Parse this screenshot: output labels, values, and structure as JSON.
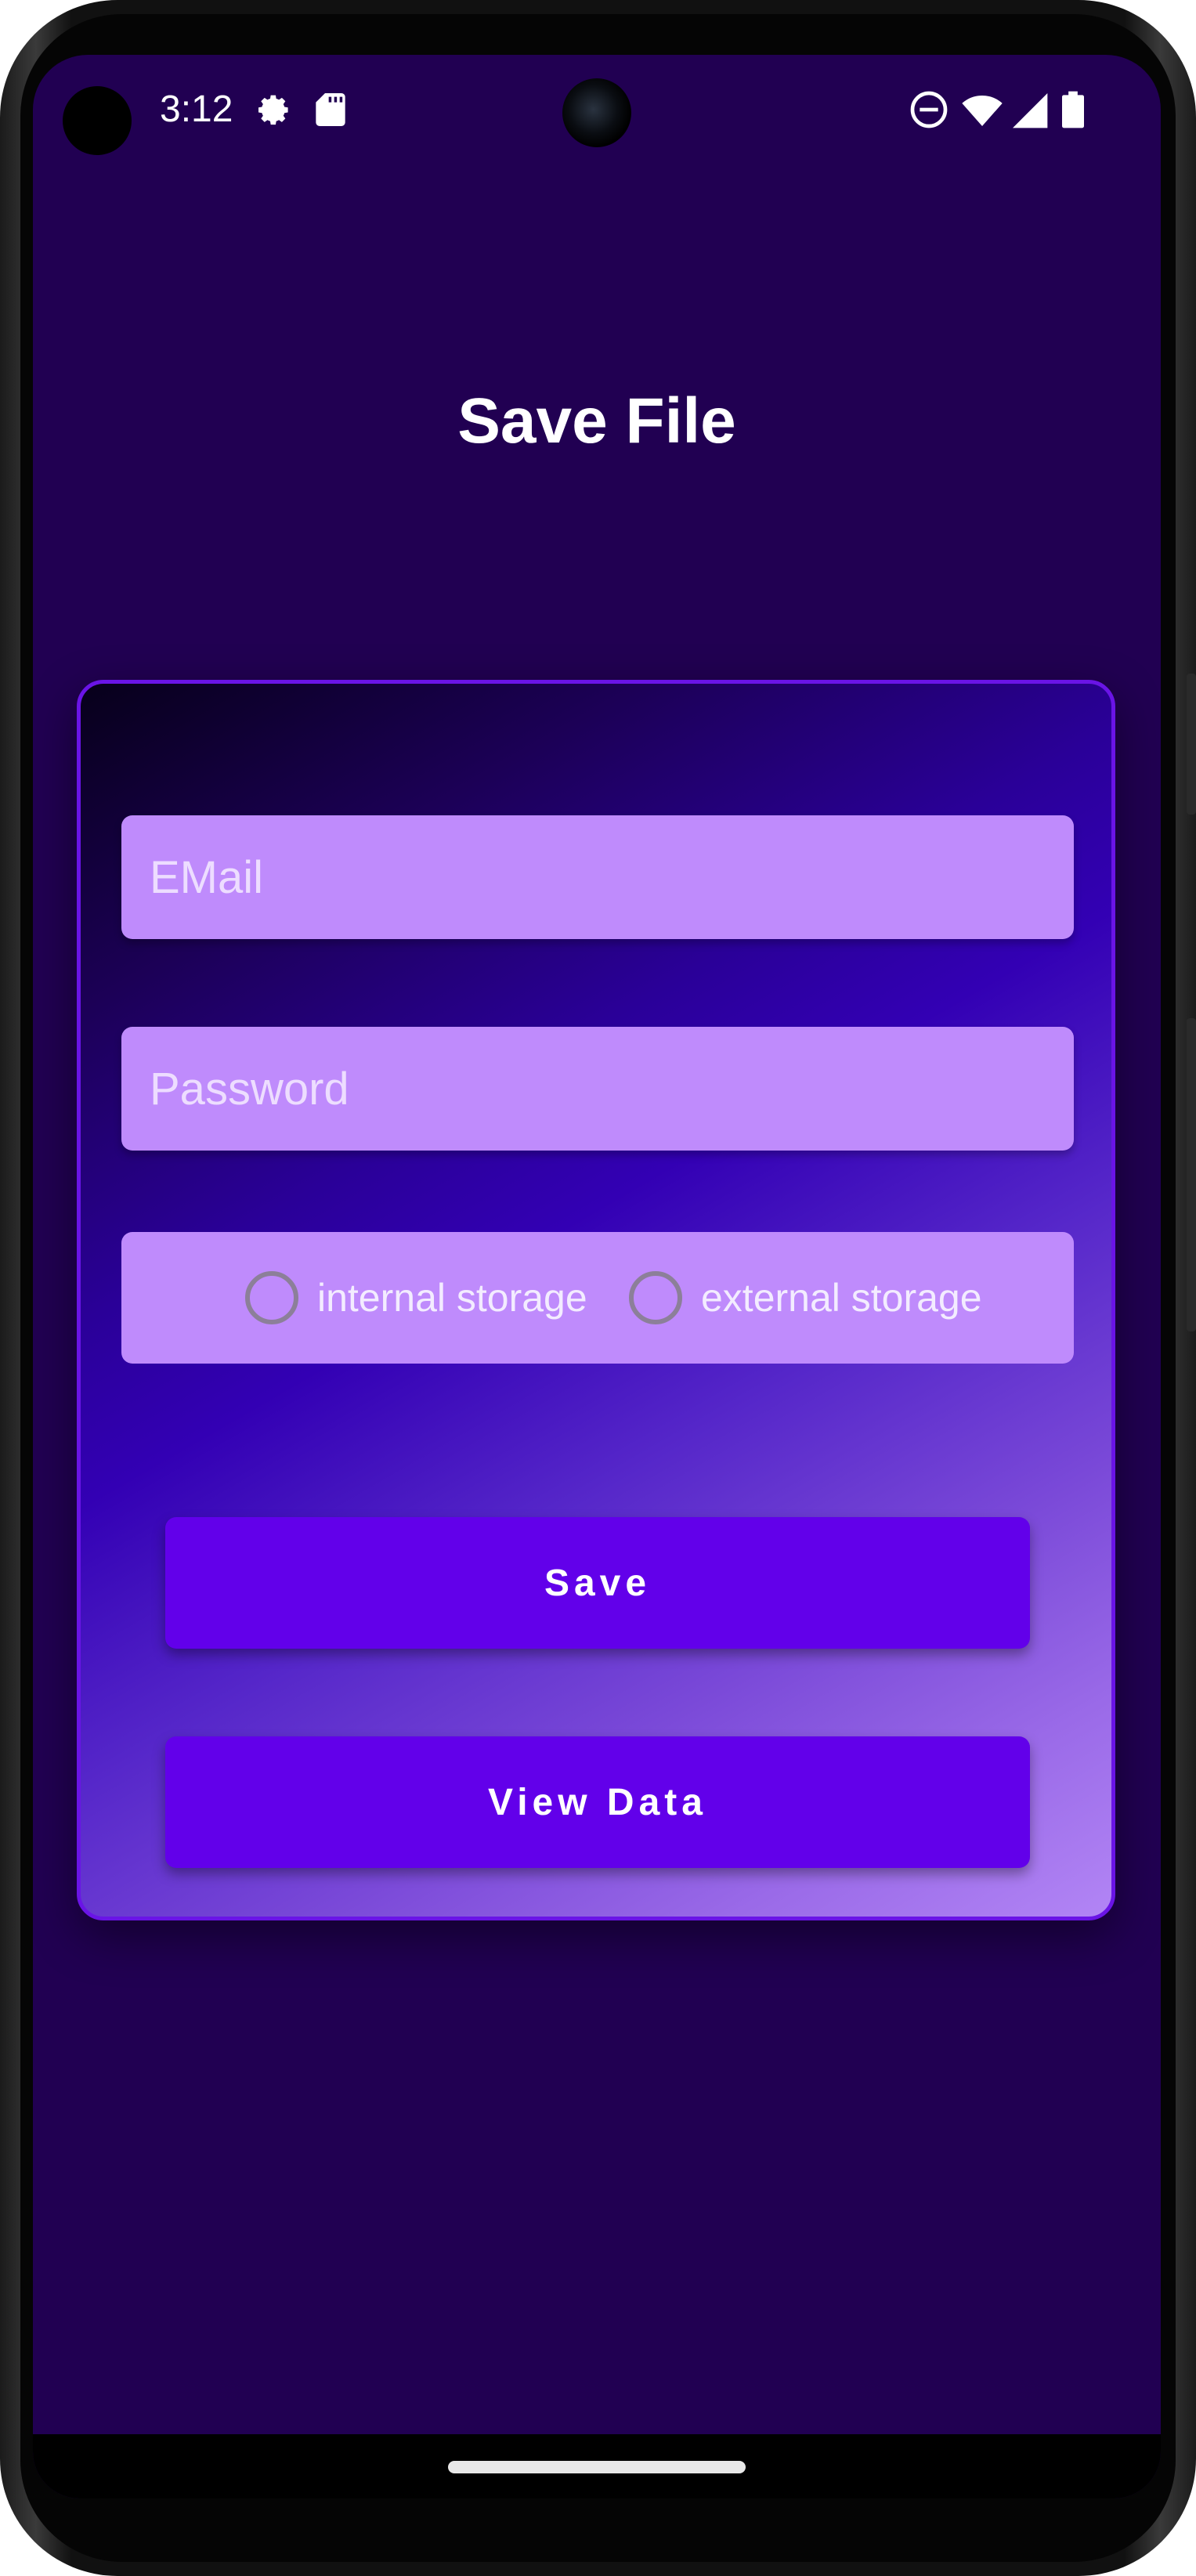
{
  "status_bar": {
    "time": "3:12",
    "icons_left": [
      "gear-icon",
      "sd-card-icon"
    ],
    "icons_right": [
      "do-not-disturb-icon",
      "wifi-icon",
      "cell-signal-icon",
      "battery-icon"
    ]
  },
  "page": {
    "title": "Save File"
  },
  "form": {
    "email": {
      "value": "",
      "placeholder": "EMail"
    },
    "password": {
      "value": "",
      "placeholder": "Password"
    },
    "storage_options": [
      {
        "label": "internal storage",
        "selected": false
      },
      {
        "label": "external storage",
        "selected": false
      }
    ],
    "save_label": "Save",
    "view_data_label": "View Data"
  },
  "colors": {
    "background": "#210052",
    "card_border": "#6a14e6",
    "input_fill": "#bf8bfc",
    "button_fill": "#6200ea",
    "text": "#ffffff"
  }
}
